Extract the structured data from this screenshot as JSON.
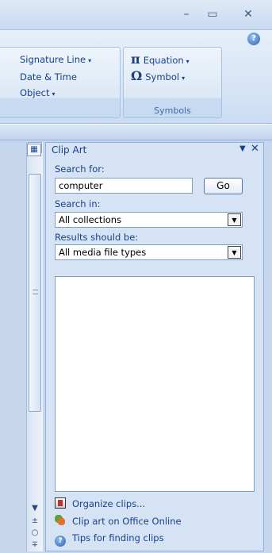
{
  "window": {
    "minimize_glyph": "–",
    "maximize_glyph": "▭",
    "close_glyph": "✕",
    "help_glyph": "?"
  },
  "ribbon": {
    "text_group": {
      "items": [
        {
          "label": "Signature Line",
          "has_dropdown": true
        },
        {
          "label": "Date & Time",
          "has_dropdown": false
        },
        {
          "label": "Object",
          "has_dropdown": true
        }
      ]
    },
    "symbols_group": {
      "label": "Symbols",
      "items": [
        {
          "glyph": "π",
          "label": "Equation",
          "has_dropdown": true
        },
        {
          "glyph": "Ω",
          "label": "Symbol",
          "has_dropdown": true
        }
      ]
    },
    "dropdown_glyph": "▾"
  },
  "task_pane": {
    "title": "Clip Art",
    "menu_glyph": "▼",
    "close_glyph": "✕",
    "search_for_label": "Search for:",
    "search_value": "computer",
    "go_label": "Go",
    "search_in_label": "Search in:",
    "search_in_value": "All collections",
    "results_label": "Results should be:",
    "results_value": "All media file types",
    "links": [
      {
        "label": "Organize clips...",
        "icon": "organize-clips-icon"
      },
      {
        "label": "Clip art on Office Online",
        "icon": "office-online-icon"
      },
      {
        "label": "Tips for finding clips",
        "icon": "help-tips-icon"
      }
    ]
  },
  "scrollbar": {
    "up_glyph": "▲",
    "down_glyph": "▼",
    "prev_page_glyph": "±",
    "select_browse_glyph": "○",
    "next_page_glyph": "∓"
  }
}
